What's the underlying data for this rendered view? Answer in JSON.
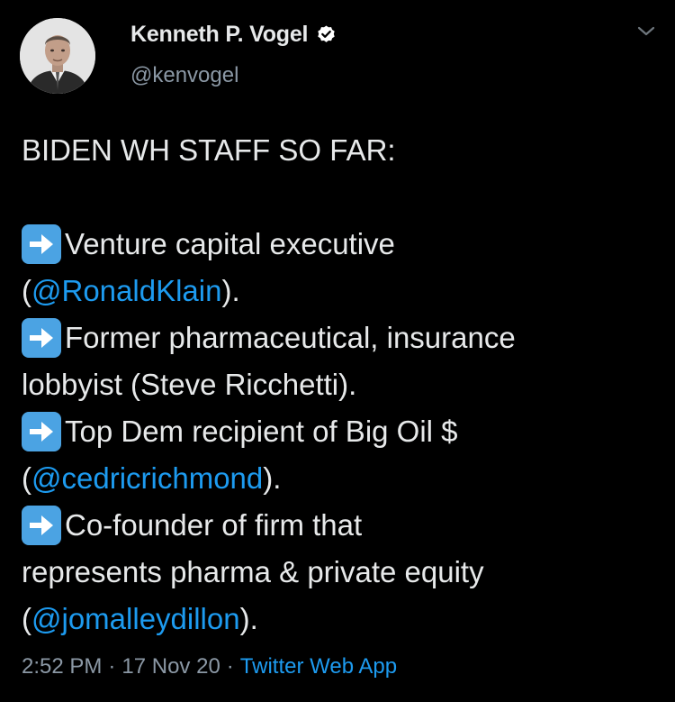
{
  "author": {
    "display_name": "Kenneth P. Vogel",
    "handle": "@kenvogel",
    "verified": true
  },
  "tweet": {
    "line1": "BIDEN WH STAFF SO FAR:",
    "item1_text": "Venture capital executive",
    "item1_cont_prefix": "(",
    "item1_mention": "@RonaldKlain",
    "item1_cont_suffix": ").",
    "item2_text": "Former pharmaceutical, insurance",
    "item2_cont": "lobbyist (Steve Ricchetti).",
    "item3_text": "Top Dem recipient of Big Oil $",
    "item3_cont_prefix": "(",
    "item3_mention": "@cedricrichmond",
    "item3_cont_suffix": ").",
    "item4_text": "Co-founder of firm that",
    "item4_cont": "represents pharma & private equity",
    "item4_cont2_prefix": "(",
    "item4_mention": "@jomalleydillon",
    "item4_cont2_suffix": ")."
  },
  "meta": {
    "time": "2:52 PM",
    "separator": "·",
    "date": "17 Nov 20",
    "source": "Twitter Web App"
  },
  "icons": {
    "verified": "verified-badge-icon",
    "caret": "chevron-down-icon",
    "arrow": "right-arrow-emoji-icon"
  },
  "colors": {
    "background": "#000000",
    "text": "#e7e9ea",
    "secondary": "#8b98a5",
    "link": "#1d9bf0",
    "emoji_bg": "#4ba3e3"
  }
}
